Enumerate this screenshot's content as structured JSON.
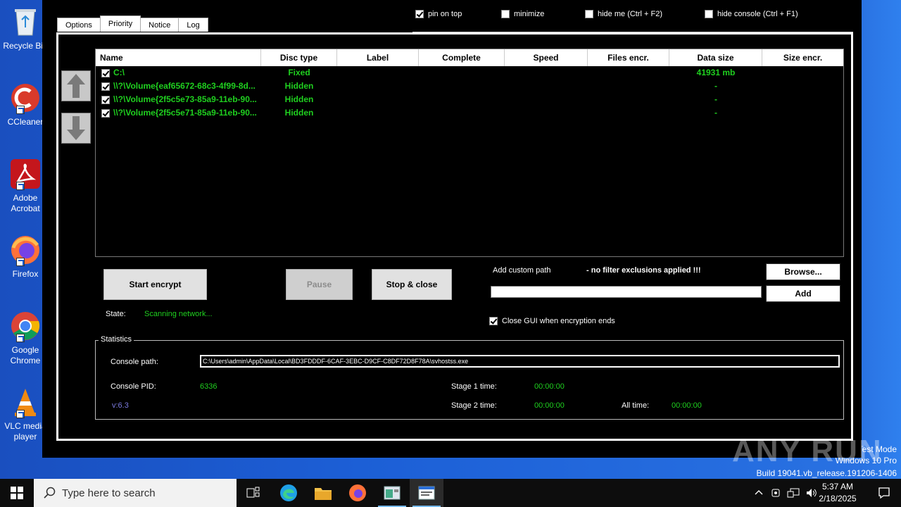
{
  "desktop": {
    "icons": [
      {
        "label": "Recycle Bin"
      },
      {
        "label": "CCleaner"
      },
      {
        "label": "Adobe Acrobat"
      },
      {
        "label": "Firefox"
      },
      {
        "label": "Google Chrome"
      },
      {
        "label": "VLC media player"
      }
    ]
  },
  "top_checks": {
    "pin_on_top": "pin on top",
    "minimize": "minimize",
    "hide_me": "hide me (Ctrl + F2)",
    "hide_console": "hide console (Ctrl + F1)"
  },
  "tabs": [
    "Options",
    "Priority",
    "Notice",
    "Log"
  ],
  "active_tab": "Priority",
  "table": {
    "headers": {
      "name": "Name",
      "disc": "Disc type",
      "label": "Label",
      "complete": "Complete",
      "speed": "Speed",
      "files": "Files encr.",
      "size": "Data size",
      "senc": "Size encr."
    },
    "rows": [
      {
        "name": "C:\\",
        "disc": "Fixed",
        "label": "",
        "complete": "",
        "speed": "",
        "files": "",
        "size": "41931 mb",
        "senc": ""
      },
      {
        "name": "\\\\?\\Volume{eaf65672-68c3-4f99-8d...",
        "disc": "Hidden",
        "label": "",
        "complete": "",
        "speed": "",
        "files": "",
        "size": "-",
        "senc": ""
      },
      {
        "name": "\\\\?\\Volume{2f5c5e73-85a9-11eb-90...",
        "disc": "Hidden",
        "label": "",
        "complete": "",
        "speed": "",
        "files": "",
        "size": "-",
        "senc": ""
      },
      {
        "name": "\\\\?\\Volume{2f5c5e71-85a9-11eb-90...",
        "disc": "Hidden",
        "label": "",
        "complete": "",
        "speed": "",
        "files": "",
        "size": "-",
        "senc": ""
      }
    ]
  },
  "controls": {
    "start": "Start encrypt",
    "pause": "Pause",
    "stop": "Stop & close",
    "add_custom_path": "Add custom path",
    "no_filter": "- no filter exclusions applied !!!",
    "browse": "Browse...",
    "add": "Add",
    "close_gui": "Close GUI when encryption ends",
    "state_label": "State:",
    "state_value": "Scanning network..."
  },
  "statistics": {
    "legend": "Statistics",
    "console_path_label": "Console path:",
    "console_path": "C:\\Users\\admin\\AppData\\Local\\BD3FDDDF-6CAF-3EBC-D9CF-C8DF72D8F78A\\svhostss.exe",
    "console_pid_label": "Console PID:",
    "console_pid": "6336",
    "version": "v:6.3",
    "stage1_label": "Stage 1 time:",
    "stage1": "00:00:00",
    "stage2_label": "Stage 2 time:",
    "stage2": "00:00:00",
    "all_time_label": "All time:",
    "all_time": "00:00:00"
  },
  "watermark": {
    "line1": "Test Mode",
    "line2": "Windows 10 Pro",
    "line3": "Build 19041.vb_release.191206-1406",
    "brand": "ANY RUN"
  },
  "taskbar": {
    "search_placeholder": "Type here to search",
    "time": "5:37 AM",
    "date": "2/18/2025"
  }
}
